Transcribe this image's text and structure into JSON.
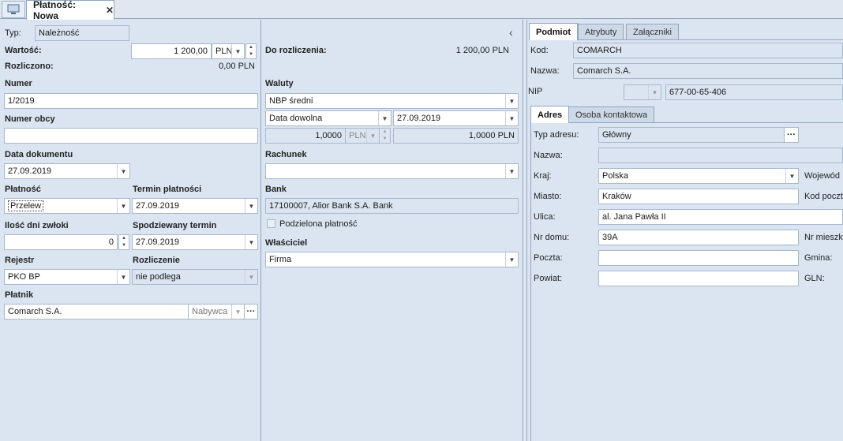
{
  "tabbar": {
    "home_icon": "monitor-icon",
    "active_tab": "Płatność: Nowa",
    "close": "✕"
  },
  "left": {
    "typ_label": "Typ:",
    "typ_value": "Należność",
    "wartosc_label": "Wartość:",
    "wartosc_value": "1 200,00",
    "wartosc_currency": "PLN",
    "rozliczono_label": "Rozliczono:",
    "rozliczono_value": "0,00 PLN",
    "numer_label": "Numer",
    "numer_value": "1/2019",
    "numer_obcy_label": "Numer obcy",
    "numer_obcy_value": "",
    "data_dok_label": "Data dokumentu",
    "data_dok_value": "27.09.2019",
    "platnosc_label": "Płatność",
    "platnosc_value": "Przelew",
    "termin_label": "Termin płatności",
    "termin_value": "27.09.2019",
    "ilosc_label": "Ilość dni zwłoki",
    "ilosc_value": "0",
    "spodz_label": "Spodziewany termin",
    "spodz_value": "27.09.2019",
    "rejestr_label": "Rejestr",
    "rejestr_value": "PKO BP",
    "rozliczenie_label": "Rozliczenie",
    "rozliczenie_value": "nie podlega",
    "platnik_label": "Płatnik",
    "platnik_value": "Comarch S.A.",
    "platnik_type": "Nabywca",
    "ellipsis": "···"
  },
  "middle": {
    "collapse": "‹",
    "do_rozl_label": "Do rozliczenia:",
    "do_rozl_value": "1 200,00 PLN",
    "waluty_label": "Waluty",
    "waluty_value": "NBP średni",
    "data_type": "Data dowolna",
    "data_value": "27.09.2019",
    "kurs1": "1,0000",
    "kurs_currency": "PLN",
    "kurs2": "1,0000 PLN",
    "rachunek_label": "Rachunek",
    "rachunek_value": "",
    "bank_label": "Bank",
    "bank_value": "17100007, Alior Bank S.A.  Bank",
    "podzielona_label": "Podzielona płatność",
    "wlasciciel_label": "Właściciel",
    "wlasciciel_value": "Firma"
  },
  "right": {
    "tabs": [
      "Podmiot",
      "Atrybuty",
      "Załączniki"
    ],
    "kod_label": "Kod:",
    "kod_value": "COMARCH",
    "nazwa_label": "Nazwa:",
    "nazwa_value": "Comarch S.A.",
    "nip_label": "NIP",
    "nip_value": "677-00-65-406",
    "subtabs": [
      "Adres",
      "Osoba kontaktowa"
    ],
    "typ_adresu_label": "Typ adresu:",
    "typ_adresu_value": "Główny",
    "a_nazwa_label": "Nazwa:",
    "a_nazwa_value": "",
    "kraj_label": "Kraj:",
    "kraj_value": "Polska",
    "wojew_label": "Wojewód",
    "miasto_label": "Miasto:",
    "miasto_value": "Kraków",
    "kod_poczt_label": "Kod poczt",
    "ulica_label": "Ulica:",
    "ulica_value": "al. Jana Pawła II",
    "nr_domu_label": "Nr domu:",
    "nr_domu_value": "39A",
    "nr_mieszk_label": "Nr mieszk",
    "poczta_label": "Poczta:",
    "poczta_value": "",
    "gmina_label": "Gmina:",
    "powiat_label": "Powiat:",
    "powiat_value": "",
    "gln_label": "GLN:"
  }
}
